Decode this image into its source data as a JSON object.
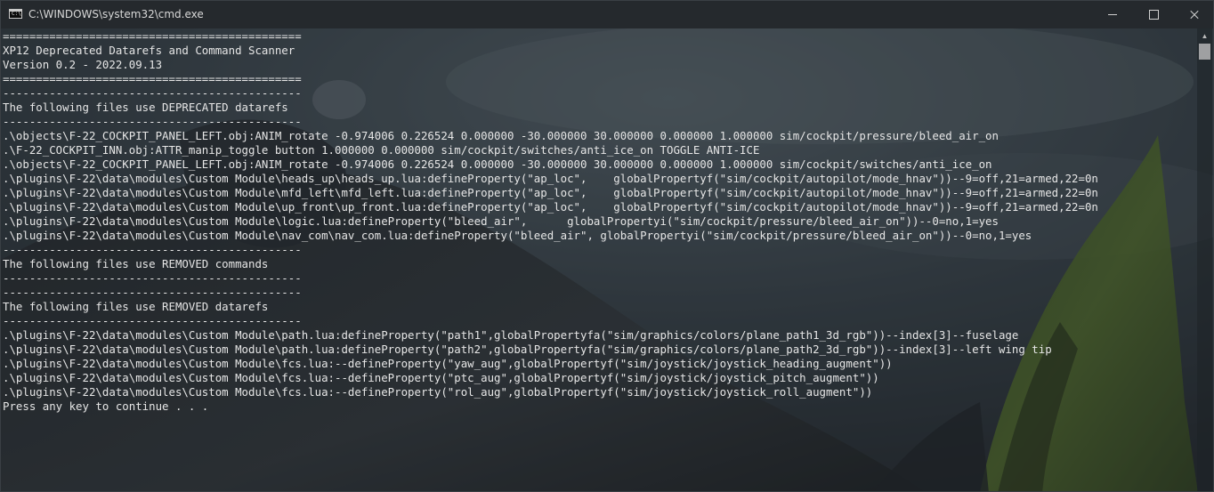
{
  "window": {
    "title": "C:\\WINDOWS\\system32\\cmd.exe",
    "icon": "cmd-prompt-icon",
    "icon_text": "C:\\"
  },
  "controls": {
    "minimize": "minimize-icon",
    "maximize": "maximize-icon",
    "close": "close-icon"
  },
  "colors": {
    "text": "#e6e6e6",
    "titlebar": "#2a2e32"
  },
  "console_lines": [
    "=============================================",
    "XP12 Deprecated Datarefs and Command Scanner",
    "Version 0.2 - 2022.09.13",
    "=============================================",
    "---------------------------------------------",
    "The following files use DEPRECATED datarefs",
    "---------------------------------------------",
    ".\\objects\\F-22_COCKPIT_PANEL_LEFT.obj:ANIM_rotate -0.974006 0.226524 0.000000 -30.000000 30.000000 0.000000 1.000000 sim/cockpit/pressure/bleed_air_on",
    ".\\F-22_COCKPIT_INN.obj:ATTR_manip_toggle button 1.000000 0.000000 sim/cockpit/switches/anti_ice_on TOGGLE ANTI-ICE",
    ".\\objects\\F-22_COCKPIT_PANEL_LEFT.obj:ANIM_rotate -0.974006 0.226524 0.000000 -30.000000 30.000000 0.000000 1.000000 sim/cockpit/switches/anti_ice_on",
    ".\\plugins\\F-22\\data\\modules\\Custom Module\\heads_up\\heads_up.lua:defineProperty(\"ap_loc\",    globalPropertyf(\"sim/cockpit/autopilot/mode_hnav\"))--9=off,21=armed,22=0n",
    ".\\plugins\\F-22\\data\\modules\\Custom Module\\mfd_left\\mfd_left.lua:defineProperty(\"ap_loc\",    globalPropertyf(\"sim/cockpit/autopilot/mode_hnav\"))--9=off,21=armed,22=0n",
    ".\\plugins\\F-22\\data\\modules\\Custom Module\\up_front\\up_front.lua:defineProperty(\"ap_loc\",    globalPropertyf(\"sim/cockpit/autopilot/mode_hnav\"))--9=off,21=armed,22=0n",
    ".\\plugins\\F-22\\data\\modules\\Custom Module\\logic.lua:defineProperty(\"bleed_air\",      globalPropertyi(\"sim/cockpit/pressure/bleed_air_on\"))--0=no,1=yes",
    ".\\plugins\\F-22\\data\\modules\\Custom Module\\nav_com\\nav_com.lua:defineProperty(\"bleed_air\", globalPropertyi(\"sim/cockpit/pressure/bleed_air_on\"))--0=no,1=yes",
    "---------------------------------------------",
    "The following files use REMOVED commands",
    "---------------------------------------------",
    "---------------------------------------------",
    "The following files use REMOVED datarefs",
    "---------------------------------------------",
    ".\\plugins\\F-22\\data\\modules\\Custom Module\\path.lua:defineProperty(\"path1\",globalPropertyfa(\"sim/graphics/colors/plane_path1_3d_rgb\"))--index[3]--fuselage",
    ".\\plugins\\F-22\\data\\modules\\Custom Module\\path.lua:defineProperty(\"path2\",globalPropertyfa(\"sim/graphics/colors/plane_path2_3d_rgb\"))--index[3]--left wing tip",
    ".\\plugins\\F-22\\data\\modules\\Custom Module\\fcs.lua:--defineProperty(\"yaw_aug\",globalPropertyf(\"sim/joystick/joystick_heading_augment\"))",
    ".\\plugins\\F-22\\data\\modules\\Custom Module\\fcs.lua:--defineProperty(\"ptc_aug\",globalPropertyf(\"sim/joystick/joystick_pitch_augment\"))",
    ".\\plugins\\F-22\\data\\modules\\Custom Module\\fcs.lua:--defineProperty(\"rol_aug\",globalPropertyf(\"sim/joystick/joystick_roll_augment\"))",
    "Press any key to continue . . ."
  ]
}
